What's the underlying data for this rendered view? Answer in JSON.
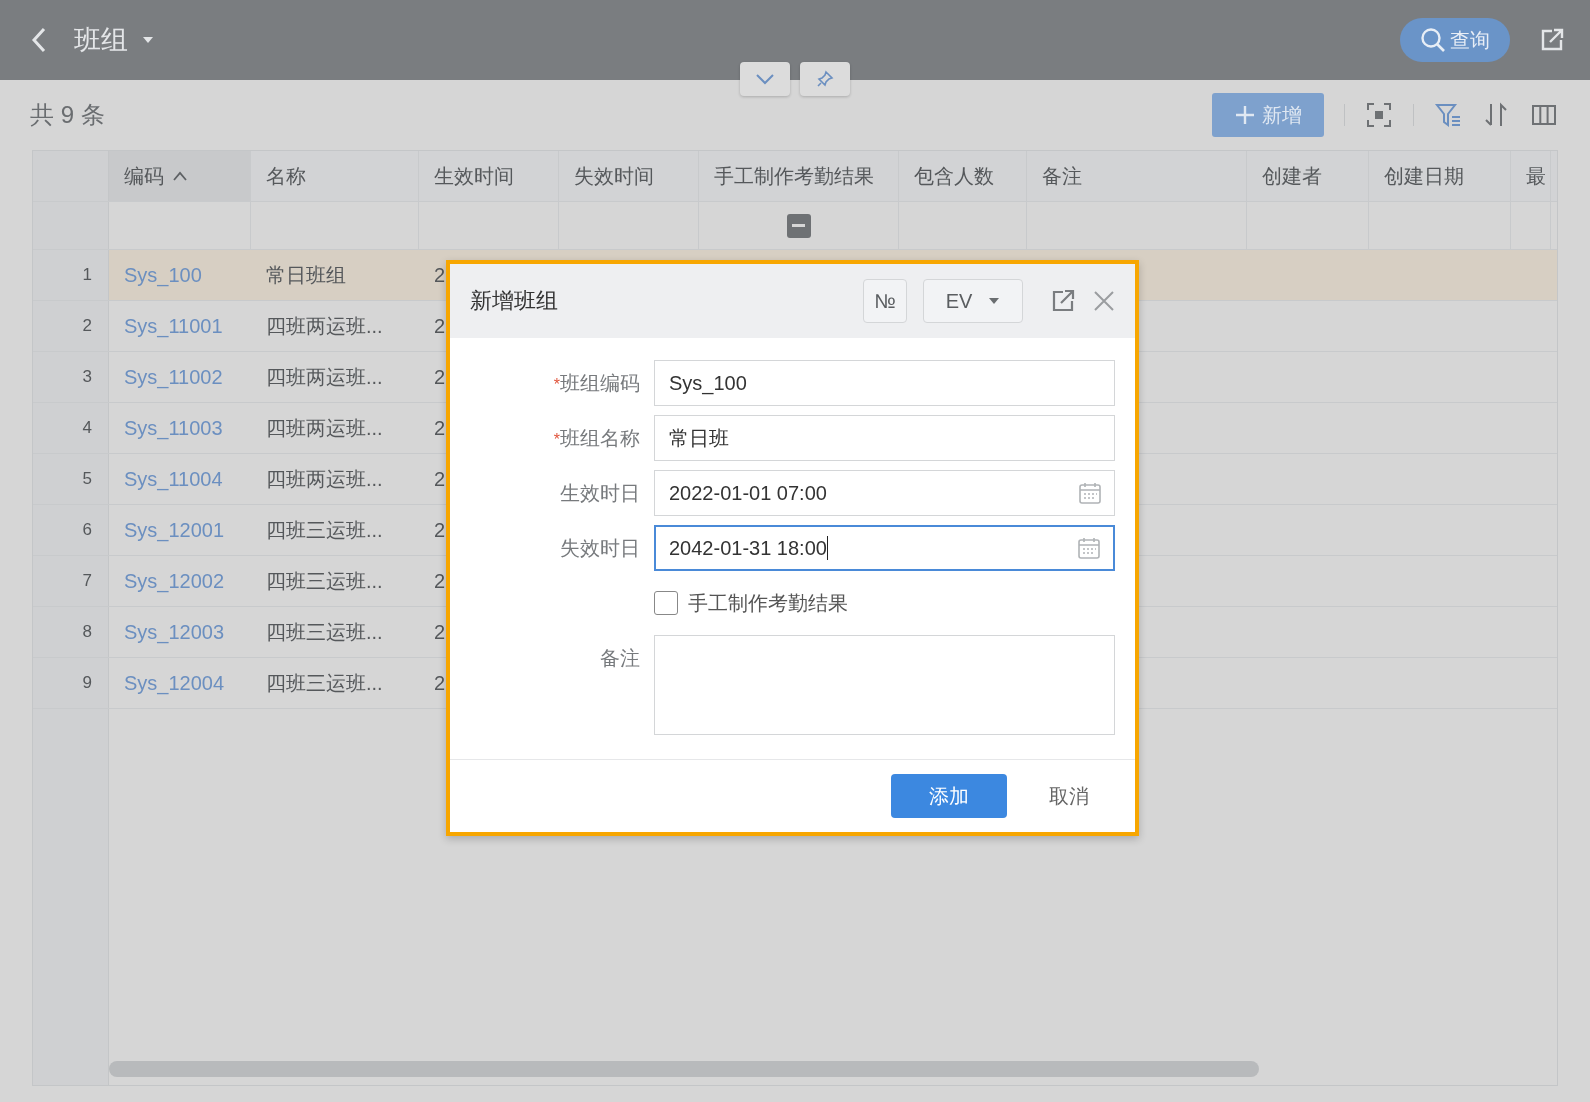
{
  "header": {
    "title": "班组",
    "query_label": "查询"
  },
  "toolbar": {
    "count": "共 9 条",
    "add_label": "新增"
  },
  "table": {
    "columns": [
      {
        "label": "编码",
        "sorted_ascending": true
      },
      {
        "label": "名称"
      },
      {
        "label": "生效时间"
      },
      {
        "label": "失效时间"
      },
      {
        "label": "手工制作考勤结果",
        "filter_indeterminate": true
      },
      {
        "label": "包含人数"
      },
      {
        "label": "备注"
      },
      {
        "label": "创建者"
      },
      {
        "label": "创建日期"
      },
      {
        "label": "最"
      }
    ],
    "rows": [
      {
        "index": "1",
        "code": "Sys_100",
        "name": "常日班组",
        "start": "2",
        "selected": true
      },
      {
        "index": "2",
        "code": "Sys_11001",
        "name": "四班两运班...",
        "start": "2",
        "selected": false
      },
      {
        "index": "3",
        "code": "Sys_11002",
        "name": "四班两运班...",
        "start": "2",
        "selected": false
      },
      {
        "index": "4",
        "code": "Sys_11003",
        "name": "四班两运班...",
        "start": "2",
        "selected": false
      },
      {
        "index": "5",
        "code": "Sys_11004",
        "name": "四班两运班...",
        "start": "2",
        "selected": false
      },
      {
        "index": "6",
        "code": "Sys_12001",
        "name": "四班三运班...",
        "start": "2",
        "selected": false
      },
      {
        "index": "7",
        "code": "Sys_12002",
        "name": "四班三运班...",
        "start": "2",
        "selected": false
      },
      {
        "index": "8",
        "code": "Sys_12003",
        "name": "四班三运班...",
        "start": "2",
        "selected": false
      },
      {
        "index": "9",
        "code": "Sys_12004",
        "name": "四班三运班...",
        "start": "2",
        "selected": false
      }
    ]
  },
  "dialog": {
    "title": "新增班组",
    "number_label": "№",
    "language": "EV",
    "fields": [
      {
        "kind": "text",
        "required_mark": "*",
        "label": "班组编码",
        "value": "Sys_100",
        "focused": false
      },
      {
        "kind": "text",
        "required_mark": "*",
        "label": "班组名称",
        "value": "常日班",
        "focused": false
      },
      {
        "kind": "date",
        "label": "生效时日",
        "value": "2022-01-01 07:00",
        "focused": false
      },
      {
        "kind": "date",
        "label": "失效时日",
        "value": "2042-01-31 18:00",
        "focused": true
      },
      {
        "kind": "checkbox",
        "label": "手工制作考勤结果",
        "checked": false
      },
      {
        "kind": "textarea",
        "label": "备注"
      }
    ],
    "confirm_label": "添加",
    "cancel_label": "取消"
  }
}
